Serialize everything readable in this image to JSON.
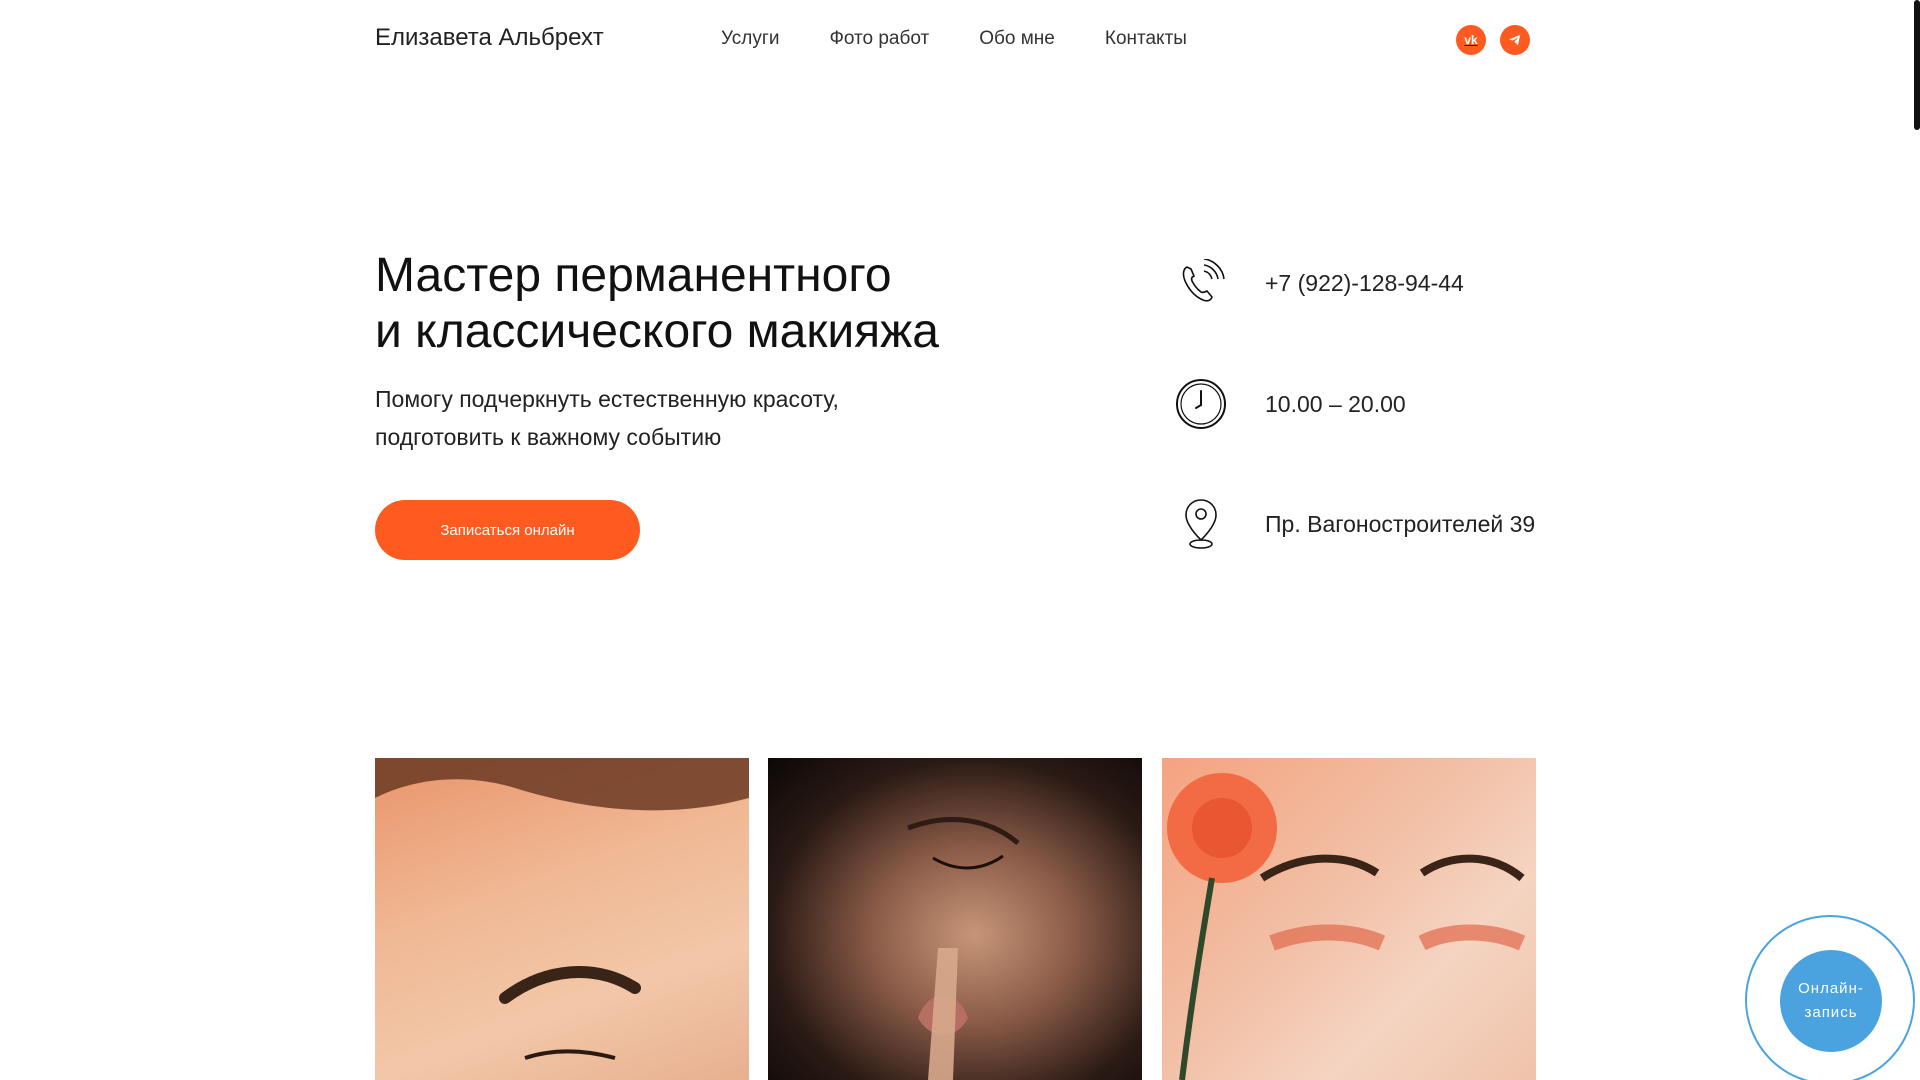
{
  "header": {
    "brand": "Елизавета Альбрехт",
    "nav": [
      "Услуги",
      "Фото работ",
      "Обо мне",
      "Контакты"
    ],
    "social": [
      {
        "name": "vk-icon",
        "glyph": "vk"
      },
      {
        "name": "telegram-icon",
        "glyph": "➤"
      }
    ]
  },
  "hero": {
    "title_line1": "Мастер перманентного",
    "title_line2": "и классического макияжа",
    "subtitle_line1": "Помогу подчеркнуть естественную красоту,",
    "subtitle_line2": "подготовить к важному событию",
    "cta_label": "Записаться онлайн"
  },
  "contacts": {
    "phone": "+7 (922)-128-94-44",
    "hours": "10.00 – 20.00",
    "address": "Пр. Вагоностроителей 39"
  },
  "widget": {
    "line1": "Онлайн-",
    "line2": "запись"
  },
  "colors": {
    "accent": "#ff5a1f",
    "widget": "#4aa3df",
    "text": "#111111"
  }
}
